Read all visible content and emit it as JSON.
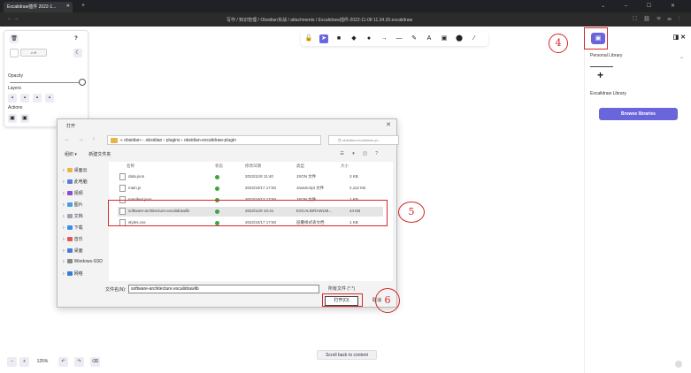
{
  "tab": {
    "title": "Excalidraw插件 2022-1...",
    "close": "✕",
    "new": "+"
  },
  "window_controls": "⌄ – ☐ ✕",
  "nav": {
    "arrows": "← →",
    "breadcrumb": "写作 / 知识管理 / Obsidian实战 / attachments / Excalidraw插件-2022-11-08 11.34.20.excalidraw",
    "icons": "⛶ ⛓ ✉ ☰ ⋮"
  },
  "left_panel": {
    "trash": "🗑",
    "help": "?",
    "swatch": "# fff",
    "moon": "☾",
    "opacity_label": "Opacity",
    "layers_label": "Layers",
    "actions_label": "Actions"
  },
  "toolbar": {
    "tools": [
      "🔓",
      "➤",
      "■",
      "◆",
      "●",
      "→",
      "—",
      "✎",
      "A",
      "▣",
      "⬤",
      "⁄"
    ]
  },
  "right_panel": {
    "library_icon": "▣",
    "icons": "◨ ✕",
    "personal_library": "Personal Library",
    "chevron": "⌄",
    "plus": "+",
    "excalidraw_library": "Excalidraw Library",
    "browse_button": "Browse libraries"
  },
  "annotations": {
    "a4": "4",
    "a5": "5",
    "a6": "6"
  },
  "dialog": {
    "title": "打开",
    "close": "✕",
    "nav": "← → ↑",
    "path": "« obsidian › .obsidian › plugins › obsidian-excalidraw-plugin",
    "search": "在 obsidian-excalidraw-pl...",
    "organize": "组织 ▾",
    "new_folder": "新建文件夹",
    "view_icons": "☰ ▾ ◫ ?",
    "tree": [
      "桌面云",
      "此电脑",
      "视频",
      "图片",
      "文档",
      "下载",
      "音乐",
      "桌面",
      "Windows-SSD",
      "网络"
    ],
    "columns": [
      "名称",
      "状态",
      "修改日期",
      "类型",
      "大小"
    ],
    "files": [
      {
        "name": "data.json",
        "date": "2022/11/8 11:40",
        "type": "JSON 文件",
        "size": "3 KB"
      },
      {
        "name": "main.js",
        "date": "2022/10/17 17:50",
        "type": "JavaScript 文件",
        "size": "2,112 KB"
      },
      {
        "name": "manifest.json",
        "date": "2022/10/17 17:50",
        "type": "JSON 文件",
        "size": "1 KB"
      },
      {
        "name": "software-architecture.excalidrawlib",
        "date": "2022/11/8 10:41",
        "type": "EXCALIDRAWLIB...",
        "size": "44 KB"
      },
      {
        "name": "styles.css",
        "date": "2022/10/17 17:50",
        "type": "层叠样式表文档",
        "size": "1 KB"
      }
    ],
    "filename_label": "文件名(N):",
    "filename_value": "software-architecture.excalidrawlib",
    "filetype": "所有文件 (*.*)",
    "open_button": "打开(O)",
    "cancel_button": "取消"
  },
  "bottom": {
    "zoom_out": "−",
    "zoom_in": "+",
    "zoom": "125%",
    "undo": "↶",
    "redo": "↷",
    "erase": "⌫",
    "scroll_back": "Scroll back to content"
  },
  "colors": {
    "accent": "#6965db",
    "annotation": "#d7262a"
  }
}
